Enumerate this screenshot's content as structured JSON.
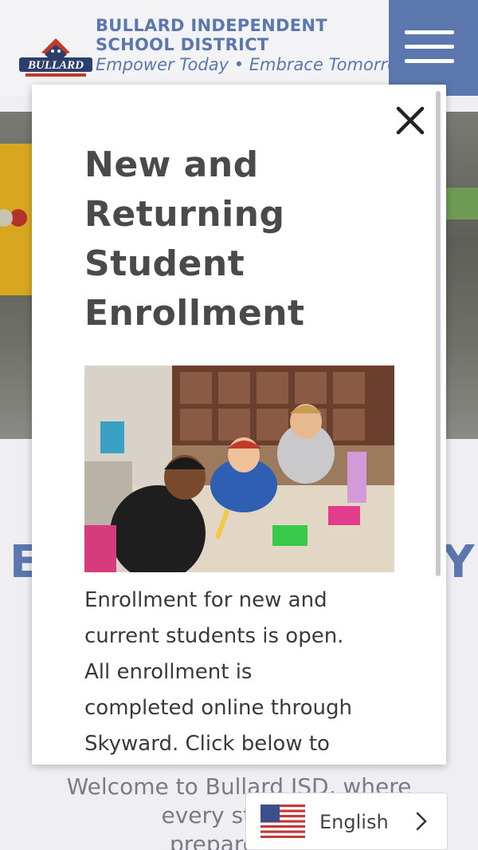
{
  "header": {
    "org_line1": "BULLARD INDEPENDENT",
    "org_line2": "SCHOOL DISTRICT",
    "tagline": "Empower Today • Embrace Tomorrow",
    "logo_text": "BULLARD",
    "menu_icon": "hamburger-icon",
    "brand_color": "#5b77ad"
  },
  "hero": {
    "partial_left": "E",
    "partial_right": "Y"
  },
  "welcome": {
    "line1": "Welcome to Bullard ISD, where",
    "line2": "every student",
    "line3": "prepared for"
  },
  "modal": {
    "title_line1": "New and",
    "title_line2": "Returning",
    "title_line3": "Student",
    "title_line4": "Enrollment",
    "close_icon": "close-icon",
    "body_line1": "Enrollment for new and",
    "body_line2": "current students is open.",
    "body_line3": "All enrollment is",
    "body_line4": "completed online through",
    "body_line5": "Skyward. Click below to"
  },
  "language": {
    "label": "English",
    "flag_icon": "us-flag-icon",
    "chevron_icon": "chevron-right-icon"
  }
}
